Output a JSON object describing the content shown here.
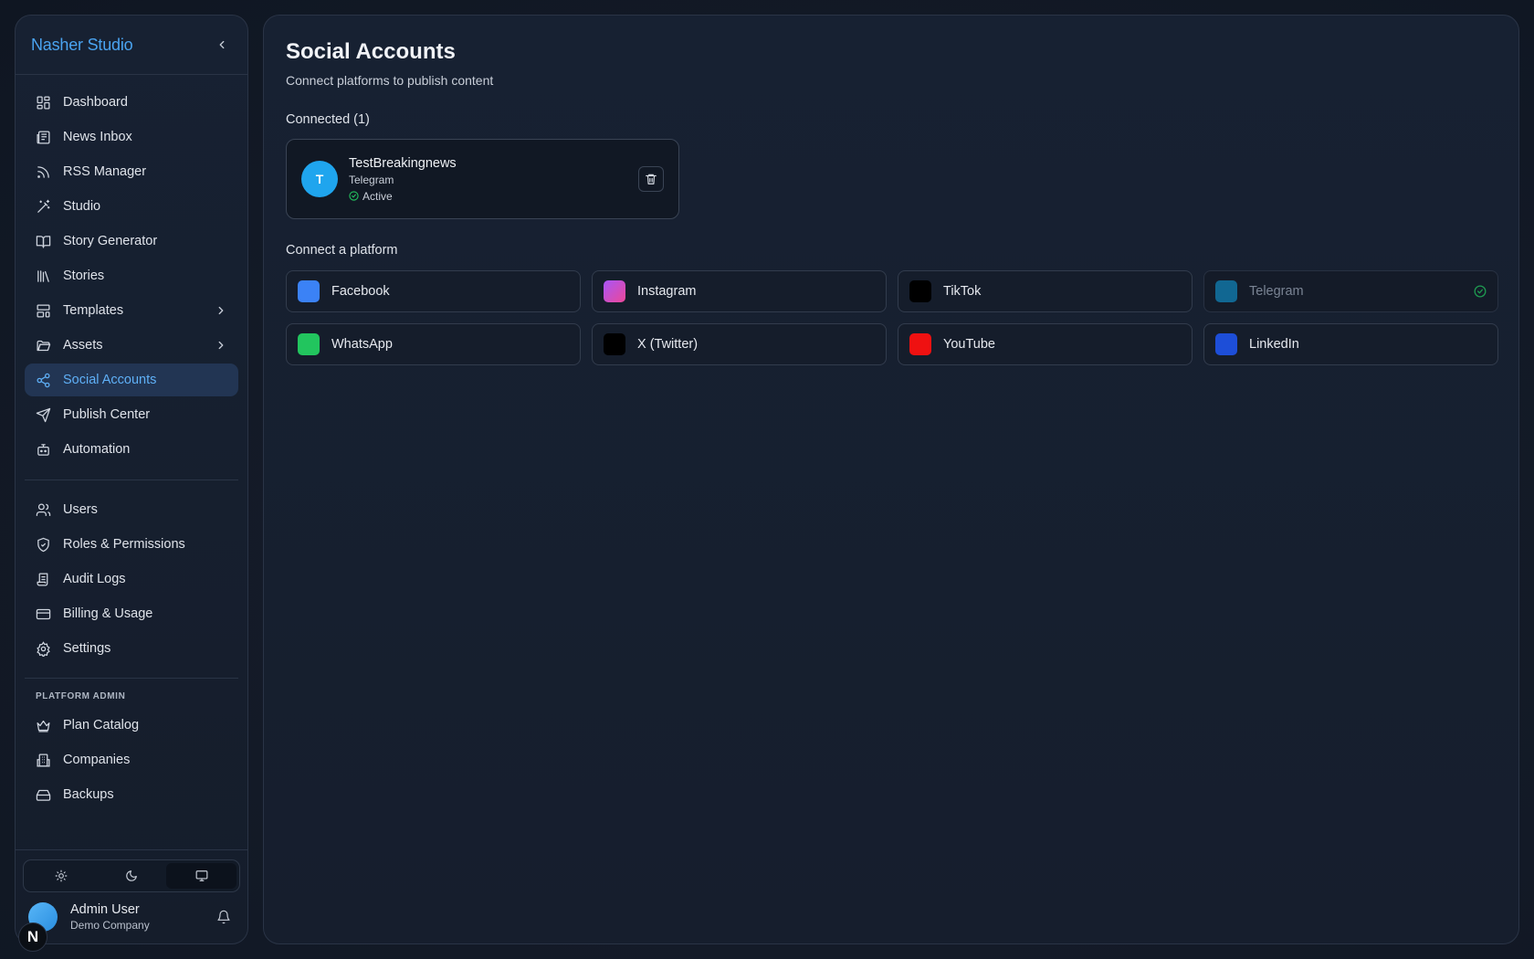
{
  "brand": "Nasher Studio",
  "sidebar": {
    "items": [
      {
        "label": "Dashboard",
        "icon": "dashboard-icon"
      },
      {
        "label": "News Inbox",
        "icon": "newspaper-icon"
      },
      {
        "label": "RSS Manager",
        "icon": "rss-icon"
      },
      {
        "label": "Studio",
        "icon": "magic-wand-icon"
      },
      {
        "label": "Story Generator",
        "icon": "book-icon"
      },
      {
        "label": "Stories",
        "icon": "library-icon"
      },
      {
        "label": "Templates",
        "icon": "template-icon"
      },
      {
        "label": "Assets",
        "icon": "folder-icon"
      },
      {
        "label": "Social Accounts",
        "icon": "share-icon",
        "active": true
      },
      {
        "label": "Publish Center",
        "icon": "send-icon"
      },
      {
        "label": "Automation",
        "icon": "bot-icon"
      }
    ],
    "admin_items": [
      {
        "label": "Users",
        "icon": "users-icon"
      },
      {
        "label": "Roles & Permissions",
        "icon": "shield-icon"
      },
      {
        "label": "Audit Logs",
        "icon": "scroll-icon"
      },
      {
        "label": "Billing & Usage",
        "icon": "credit-card-icon"
      },
      {
        "label": "Settings",
        "icon": "gear-icon"
      }
    ],
    "platform_admin_label": "PLATFORM ADMIN",
    "platform_items": [
      {
        "label": "Plan Catalog",
        "icon": "crown-icon"
      },
      {
        "label": "Companies",
        "icon": "building-icon"
      },
      {
        "label": "Backups",
        "icon": "hard-drive-icon"
      }
    ]
  },
  "user": {
    "name": "Admin User",
    "company": "Demo Company",
    "badge": "N"
  },
  "page": {
    "title": "Social Accounts",
    "subtitle": "Connect platforms to publish content",
    "connected_heading": "Connected (1)",
    "connect_heading": "Connect a platform"
  },
  "connected_account": {
    "initial": "T",
    "name": "TestBreakingnews",
    "platform": "Telegram",
    "status": "Active"
  },
  "platforms": [
    {
      "label": "Facebook",
      "color": "#3b82f6"
    },
    {
      "label": "Instagram",
      "color": "#d946ef"
    },
    {
      "label": "TikTok",
      "color": "#000000"
    },
    {
      "label": "Telegram",
      "color": "#0ea5e9",
      "connected": true
    },
    {
      "label": "WhatsApp",
      "color": "#22c55e"
    },
    {
      "label": "X (Twitter)",
      "color": "#000000"
    },
    {
      "label": "YouTube",
      "color": "#ef1111"
    },
    {
      "label": "LinkedIn",
      "color": "#1d4ed8"
    }
  ],
  "colors": {
    "accent": "#4aa3f0",
    "active_bg": "#223553",
    "success": "#22c55e"
  }
}
